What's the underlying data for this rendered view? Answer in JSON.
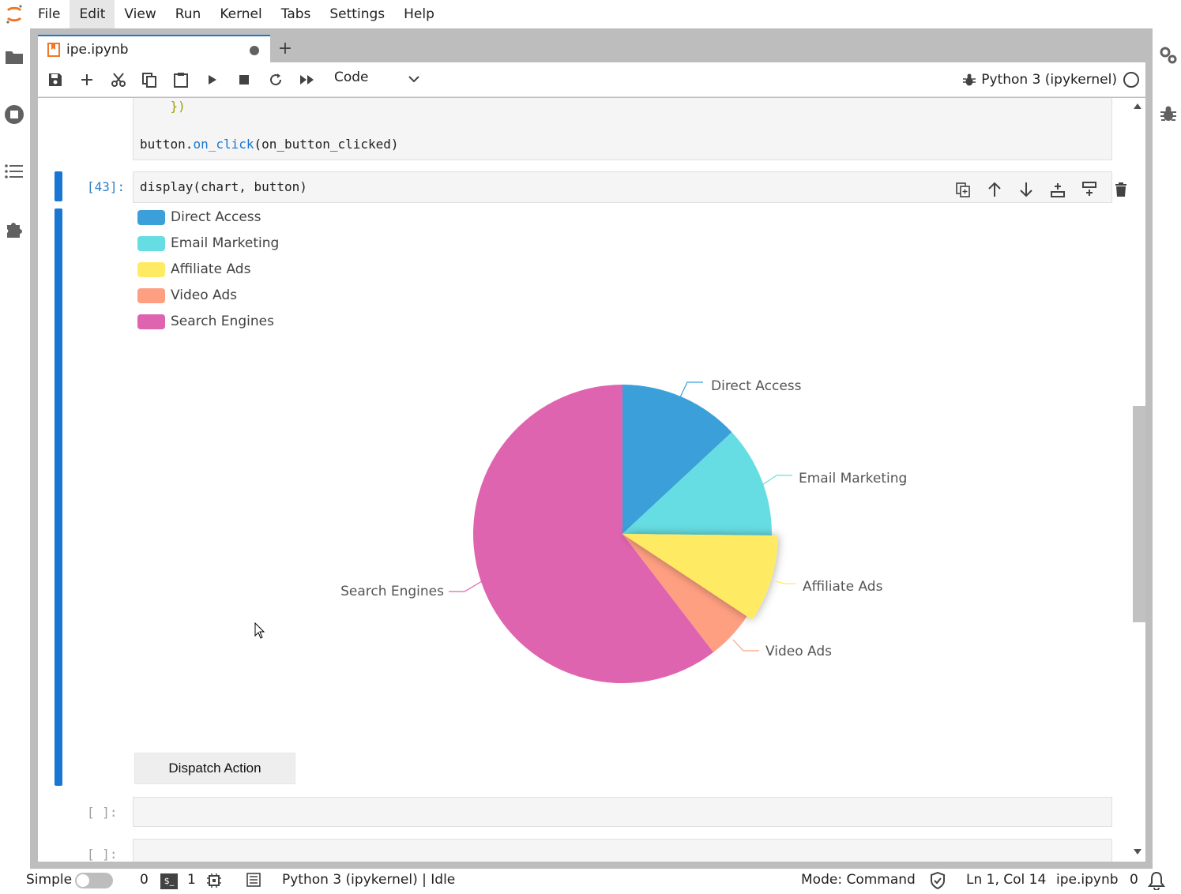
{
  "menu": [
    "File",
    "Edit",
    "View",
    "Run",
    "Kernel",
    "Tabs",
    "Settings",
    "Help"
  ],
  "tab": {
    "label": "ipe.ipynb",
    "new_tab": "+"
  },
  "toolbar": {
    "cell_type": "Code",
    "kernel": "Python 3 (ipykernel)"
  },
  "cells": {
    "prev_code_line1": "    })",
    "prev_code_obj": "button",
    "prev_code_method": "on_click",
    "prev_code_args": "(on_button_clicked)",
    "active_prompt": "[43]:",
    "active_code": "display(chart, button)",
    "empty_prompt_1": "[ ]:",
    "empty_prompt_2": "[ ]:"
  },
  "chart_data": {
    "type": "pie",
    "title": "",
    "series": [
      {
        "name": "Direct Access",
        "value": 335,
        "color": "#3ba0d9"
      },
      {
        "name": "Email Marketing",
        "value": 310,
        "color": "#66dde2"
      },
      {
        "name": "Affiliate Ads",
        "value": 234,
        "color": "#ffeb63"
      },
      {
        "name": "Video Ads",
        "value": 135,
        "color": "#ff9f81"
      },
      {
        "name": "Search Engines",
        "value": 1548,
        "color": "#df64b0"
      }
    ],
    "legend_position": "top-left",
    "emphasized_slice": "Affiliate Ads"
  },
  "widget": {
    "button_label": "Dispatch Action"
  },
  "status": {
    "mode_label": "Simple",
    "terminals": "0",
    "kernels": "1",
    "kernel_status": "Python 3 (ipykernel) | Idle",
    "mode": "Mode: Command",
    "cursor": "Ln 1, Col 14",
    "file": "ipe.ipynb",
    "notifications": "0"
  }
}
